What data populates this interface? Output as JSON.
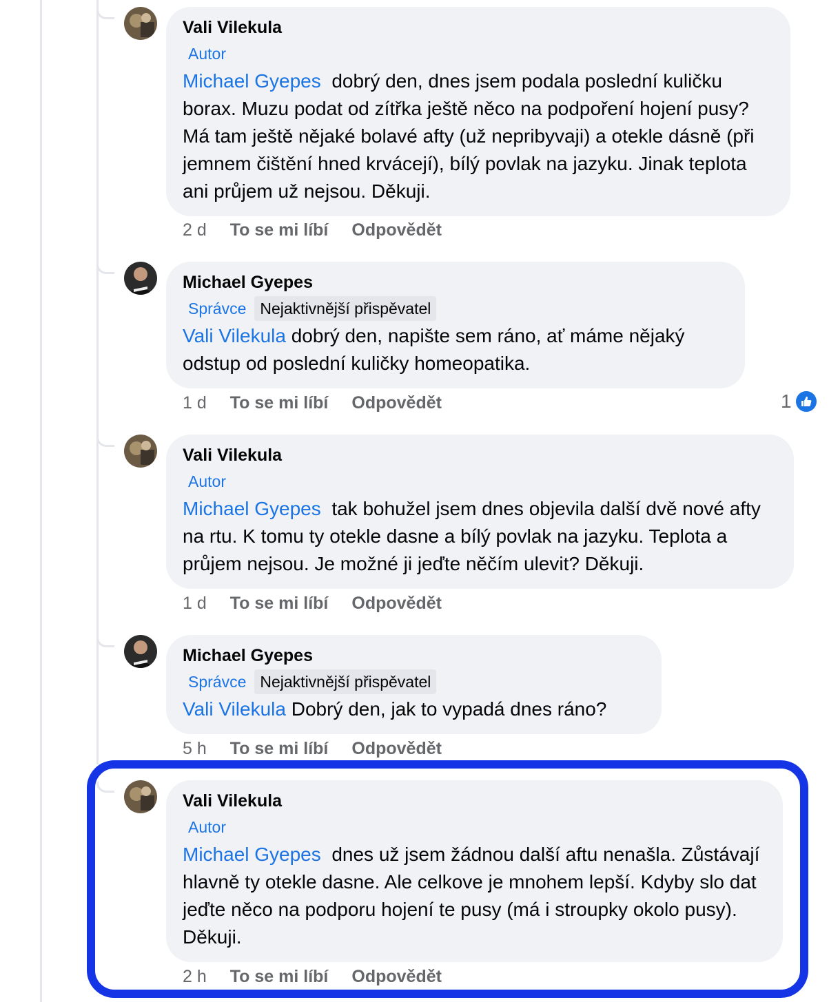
{
  "comments": [
    {
      "author": "Vali Vilekula",
      "badge_role": "Autor",
      "badge_top": "",
      "mention": "Michael Gyepes",
      "text": "dobrý den, dnes jsem podala poslední kuličku borax. Muzu podat od zítřka ještě něco na podpoření hojení pusy? Má tam ještě nějaké bolavé afty (už nepribyvaji) a otekle dásně (při jemnem čištění hned krvácejí), bílý povlak na jazyku. Jinak teplota ani průjem už nejsou. Děkuji.",
      "time": "2 d",
      "like_label": "To se mi líbí",
      "reply_label": "Odpovědět"
    },
    {
      "author": "Michael Gyepes",
      "badge_role": "Správce",
      "badge_top": "Nejaktivnější přispěvatel",
      "mention": "Vali Vilekula",
      "text": "dobrý den, napište sem ráno, ať máme nějaký odstup od poslední kuličky homeopatika.",
      "time": "1 d",
      "like_label": "To se mi líbí",
      "reply_label": "Odpovědět",
      "reaction_count": "1"
    },
    {
      "author": "Vali Vilekula",
      "badge_role": "Autor",
      "badge_top": "",
      "mention": "Michael Gyepes",
      "text": "tak bohužel jsem dnes objevila další dvě nové afty na rtu. K tomu ty otekle dasne a bílý povlak na jazyku. Teplota a průjem nejsou. Je možné ji jeďte něčím ulevit? Děkuji.",
      "time": "1 d",
      "like_label": "To se mi líbí",
      "reply_label": "Odpovědět"
    },
    {
      "author": "Michael Gyepes",
      "badge_role": "Správce",
      "badge_top": "Nejaktivnější přispěvatel",
      "mention": "Vali Vilekula",
      "text": "Dobrý den, jak to vypadá dnes ráno?",
      "time": "5 h",
      "like_label": "To se mi líbí",
      "reply_label": "Odpovědět"
    },
    {
      "author": "Vali Vilekula",
      "badge_role": "Autor",
      "badge_top": "",
      "mention": "Michael Gyepes",
      "text": "dnes už jsem žádnou další aftu nenašla. Zůstávají hlavně ty otekle dasne. Ale celkove je mnohem lepší. Kdyby slo dat jeďte něco na podporu hojení te pusy (má i stroupky okolo pusy).  Děkuji.",
      "time": "2 h",
      "like_label": "To se mi líbí",
      "reply_label": "Odpovědět"
    }
  ],
  "colors": {
    "mention": "#1b74e4",
    "bubble": "#f0f2f5",
    "highlight": "#1534e6"
  }
}
